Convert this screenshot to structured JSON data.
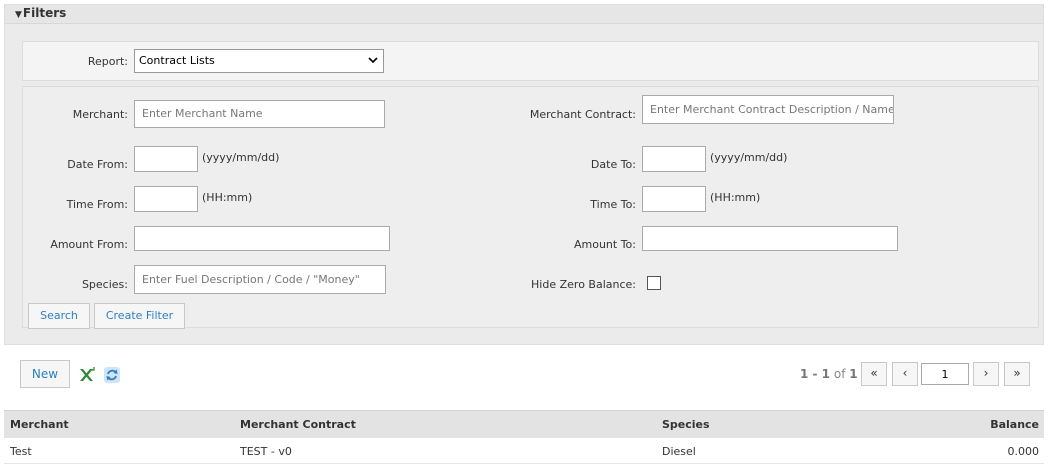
{
  "filters": {
    "title": "Filters",
    "report": {
      "label": "Report:",
      "selected": "Contract Lists"
    },
    "merchant": {
      "label": "Merchant:",
      "placeholder": "Enter Merchant Name"
    },
    "merchant_contract": {
      "label": "Merchant Contract:",
      "placeholder": "Enter Merchant Contract Description / Name"
    },
    "date_from": {
      "label": "Date From:",
      "hint": "(yyyy/mm/dd)"
    },
    "date_to": {
      "label": "Date To:",
      "hint": "(yyyy/mm/dd)"
    },
    "time_from": {
      "label": "Time From:",
      "hint": "(HH:mm)"
    },
    "time_to": {
      "label": "Time To:",
      "hint": "(HH:mm)"
    },
    "amount_from": {
      "label": "Amount From:"
    },
    "amount_to": {
      "label": "Amount To:"
    },
    "species": {
      "label": "Species:",
      "placeholder": "Enter Fuel Description / Code / \"Money\""
    },
    "hide_zero_balance": {
      "label": "Hide Zero Balance:",
      "checked": false
    },
    "search_label": "Search",
    "create_filter_label": "Create Filter"
  },
  "toolbar": {
    "new_label": "New",
    "excel_icon": "excel-export-icon",
    "refresh_icon": "refresh-icon"
  },
  "pager": {
    "range": "1 - 1",
    "of_text": "of",
    "total": "1",
    "first": "«",
    "prev": "‹",
    "page": "1",
    "next": "›",
    "last": "»"
  },
  "table": {
    "columns": [
      "Merchant",
      "Merchant Contract",
      "Species",
      "Balance"
    ],
    "rows": [
      [
        "Test",
        "TEST - v0",
        "Diesel",
        "0.000"
      ]
    ]
  },
  "colors": {
    "accent_link": "#2e7fbf",
    "panel_bg": "#ebebeb",
    "header_bg": "#e3e3e3"
  }
}
